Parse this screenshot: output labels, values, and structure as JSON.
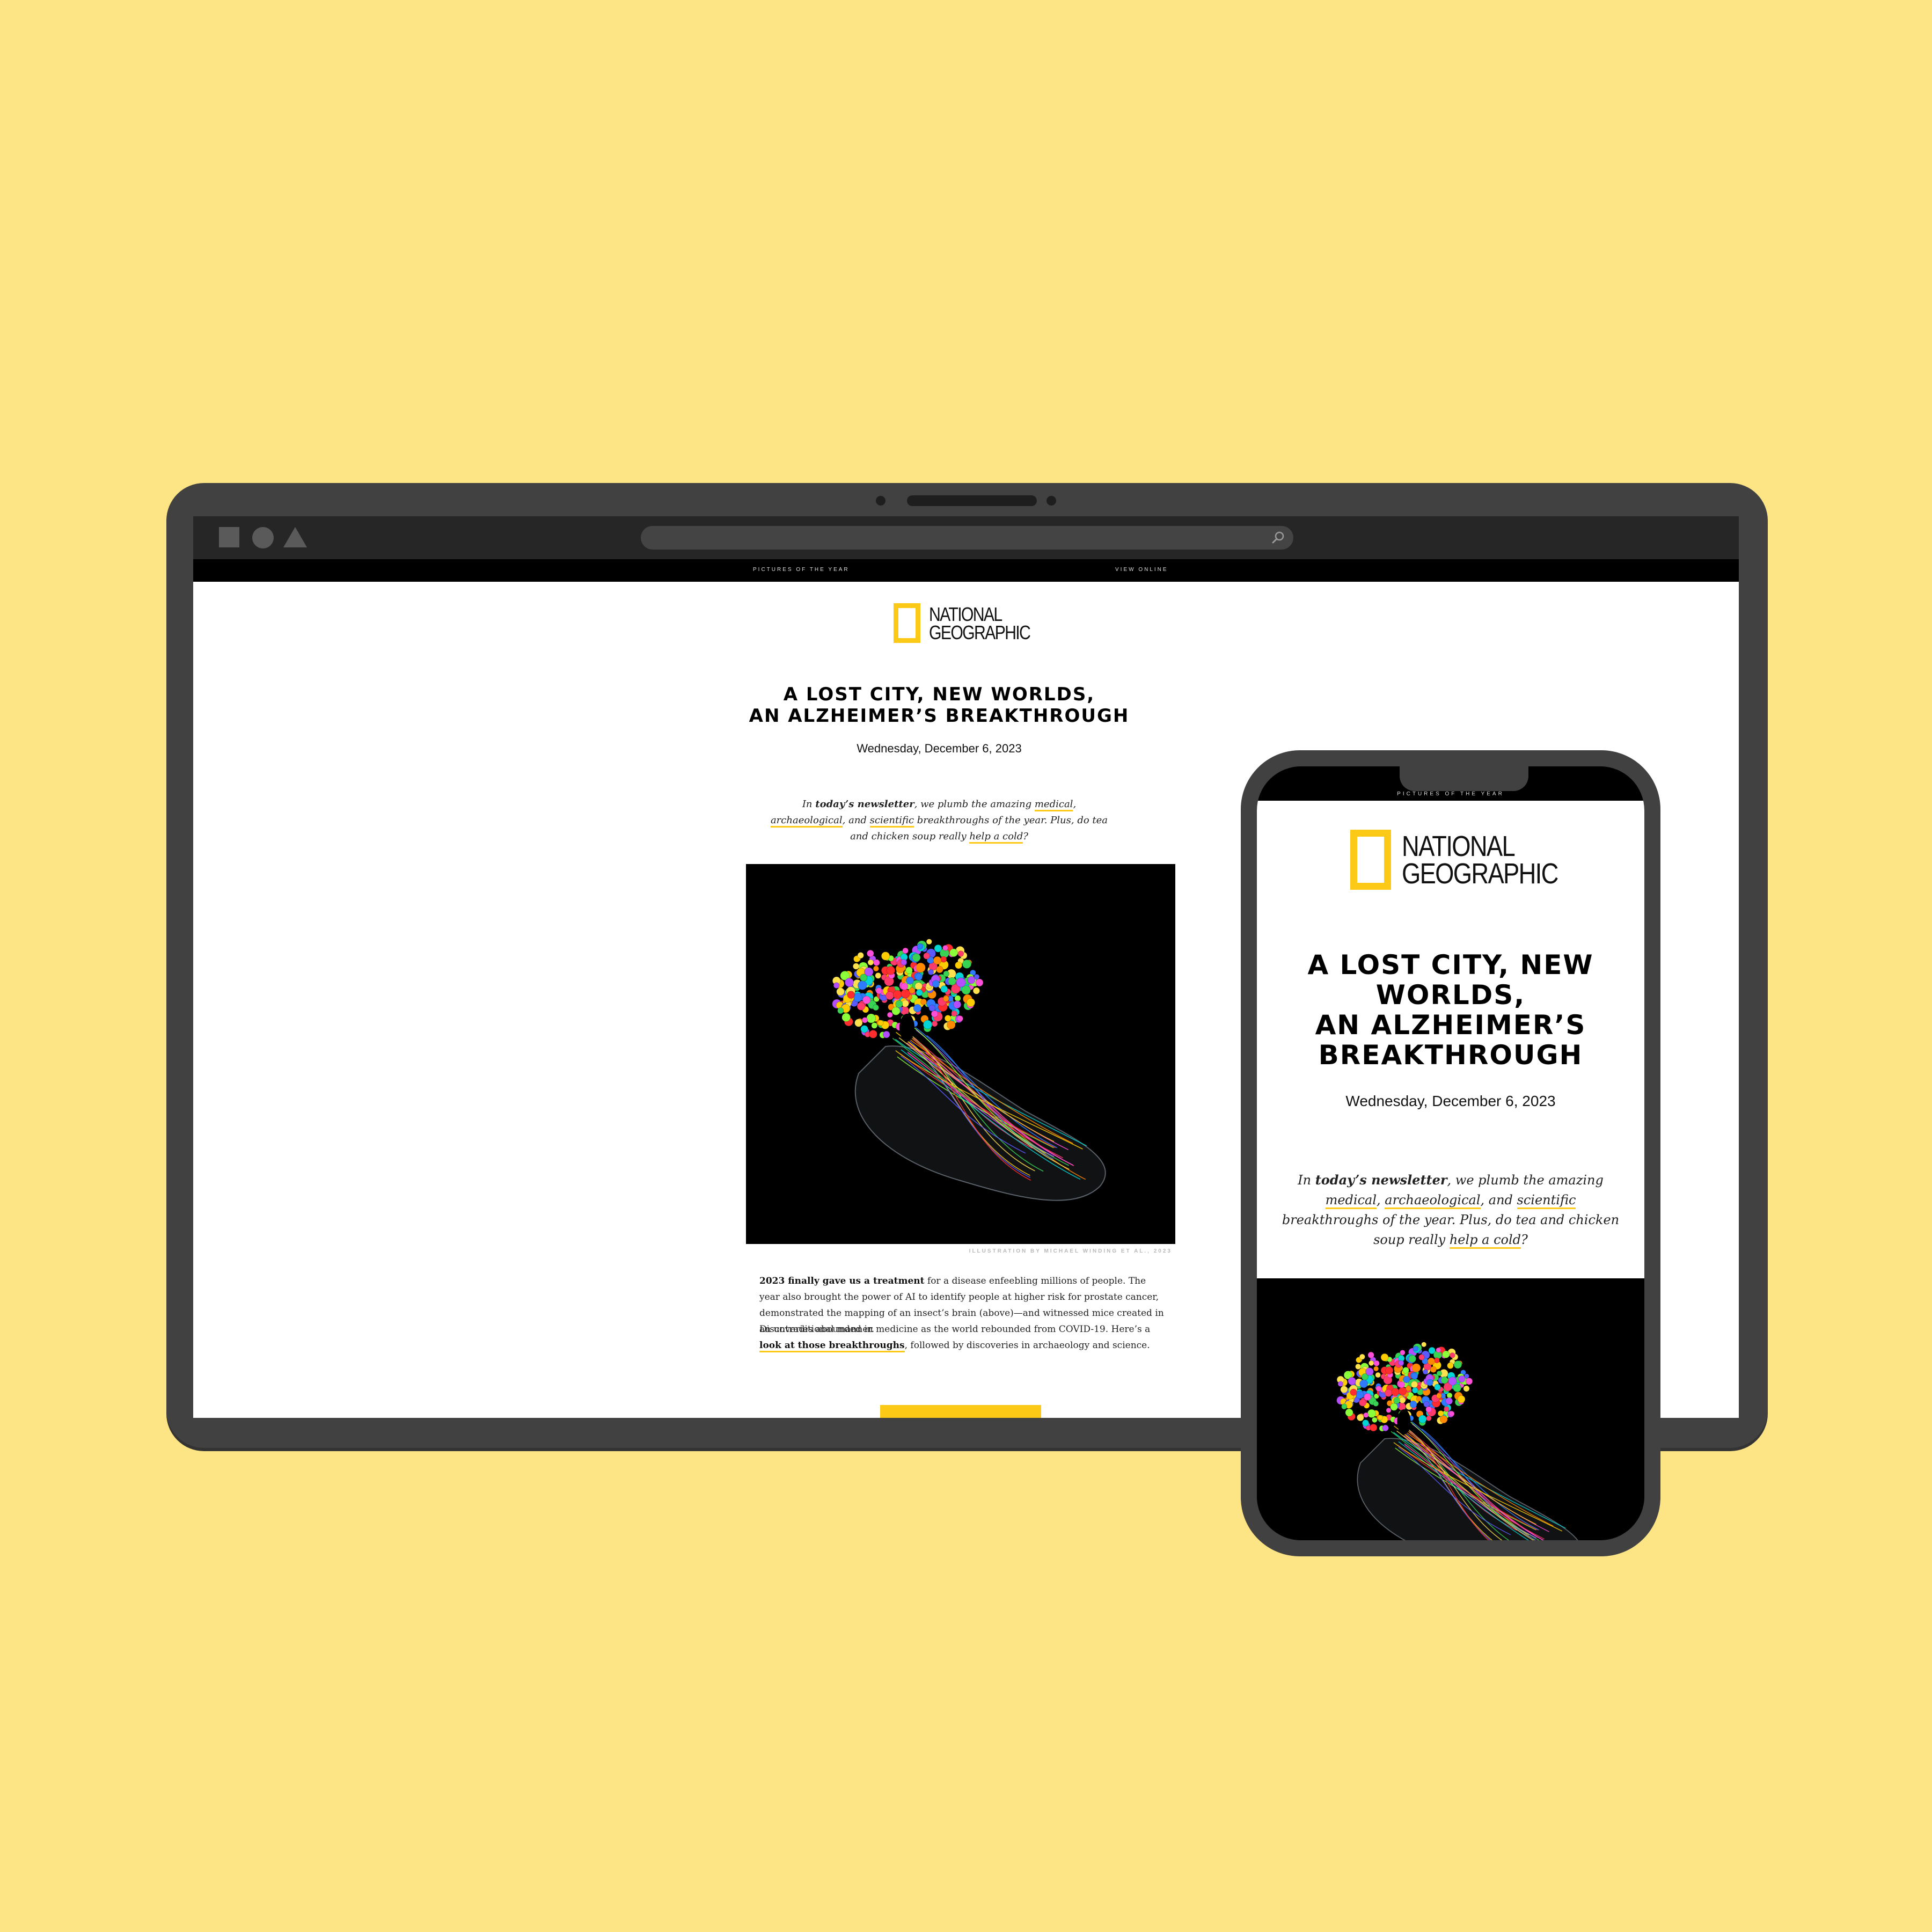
{
  "topnav": {
    "left_link": "PICTURES OF THE YEAR",
    "right_link": "VIEW ONLINE"
  },
  "brand": {
    "line1": "NATIONAL",
    "line2": "GEOGRAPHIC",
    "accent": "#fbc916"
  },
  "email": {
    "headline_line1": "A LOST CITY, NEW WORLDS,",
    "headline_line2": "AN ALZHEIMER’S BREAKTHROUGH",
    "date": "Wednesday, December 6, 2023",
    "intro": {
      "p1": "In ",
      "bold": "today’s newsletter",
      "p2": ", we plumb the amazing ",
      "link_medical": "medical",
      "sep1": ", ",
      "link_archaeological": "archaeological",
      "sep2": ", and ",
      "link_scientific": "scientific",
      "p3": " breakthroughs of the year. Plus, do tea and chicken soup really ",
      "link_help": "help a cold",
      "p4": "?"
    },
    "image_credit": "ILLUSTRATION BY MICHAEL WINDING ET AL., 2023",
    "body1_bold": "2023 finally gave us a treatment",
    "body1_rest": " for a disease enfeebling millions of people. The year also brought the power of AI to identify people at higher risk for prostate cancer, demonstrated the mapping of an insect’s brain (above)—and witnessed mice created in an untraditional manner.",
    "body2_start": "Discoveries abounded in medicine as the world rebounded from COVID-19. Here’s a ",
    "body2_link": "look at those breakthroughs",
    "body2_end": ", followed by discoveries in archaeology and science."
  },
  "phone": {
    "nav_text": "PICTURES OF THE YEAR",
    "headline_lines": [
      "A LOST CITY, NEW",
      "WORLDS,",
      "AN ALZHEIMER’S",
      "BREAKTHROUGH"
    ]
  },
  "colors": {
    "background": "#fde585",
    "device_frame": "#414141",
    "browser_chrome": "#262626"
  },
  "icons": {
    "window_controls": [
      "square-icon",
      "circle-icon",
      "triangle-icon"
    ],
    "url_bar": "search-icon"
  }
}
